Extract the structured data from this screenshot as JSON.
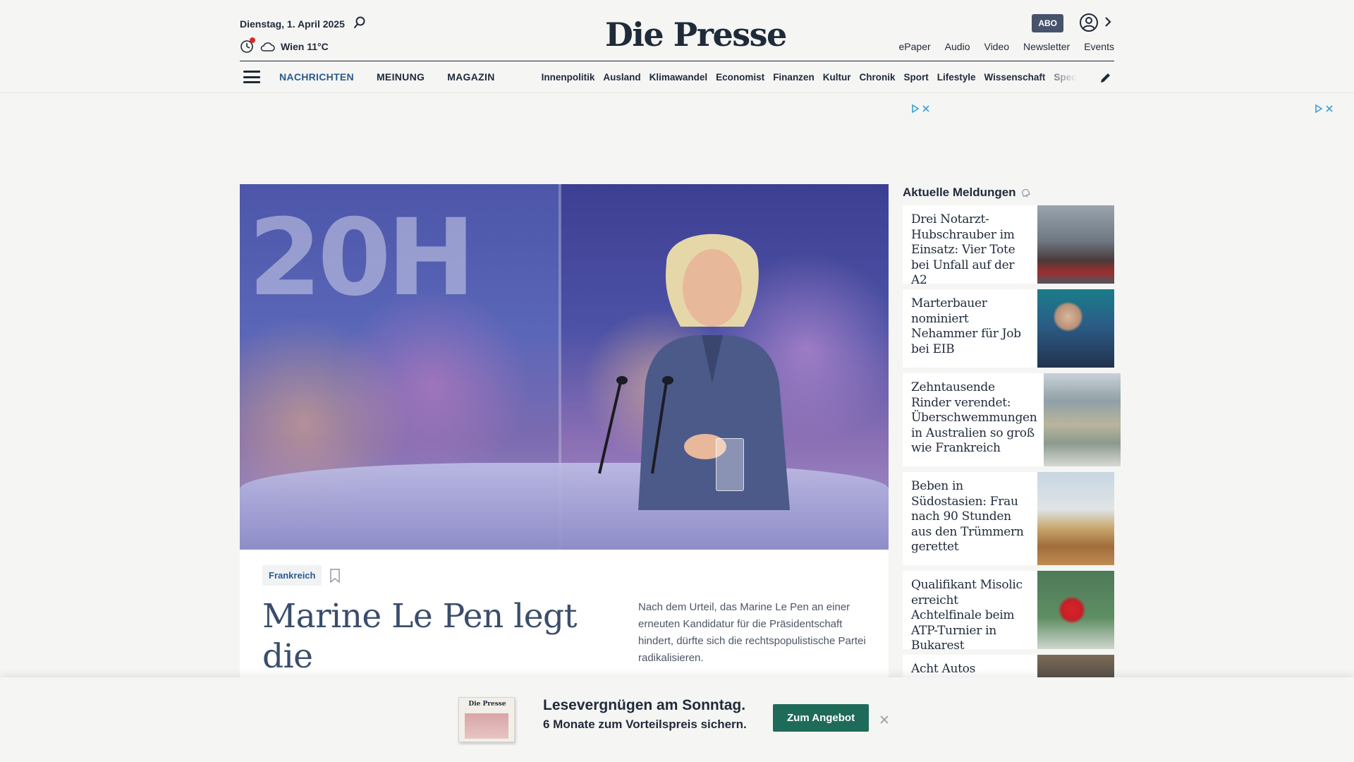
{
  "header": {
    "date": "Dienstag, 1. April 2025",
    "weather": "Wien 11°C",
    "logo": "Die Presse",
    "abo_label": "ABO",
    "top_links": [
      "ePaper",
      "Audio",
      "Video",
      "Newsletter",
      "Events"
    ]
  },
  "nav": {
    "main_tabs": [
      "NACHRICHTEN",
      "MEINUNG",
      "MAGAZIN"
    ],
    "sub_links": [
      "Innenpolitik",
      "Ausland",
      "Klimawandel",
      "Economist",
      "Finanzen",
      "Kultur",
      "Chronik",
      "Sport",
      "Lifestyle",
      "Wissenschaft",
      "Spectrum"
    ]
  },
  "hero": {
    "screen_text": "20H",
    "tag": "Frankreich",
    "headline": "Marine Le Pen legt die Glacéhandschuhe",
    "teaser": "Nach dem Urteil, das Marine Le Pen an einer erneuten Kandidatur für die Präsidentschaft hindert, dürfte sich die rechtspopulistische Partei radikalisieren."
  },
  "sidebar": {
    "title": "Aktuelle Meldungen",
    "items": [
      {
        "title": "Drei Notarzt-Hubschrauber im Einsatz: Vier Tote bei Unfall auf der A2"
      },
      {
        "title": "Marterbauer nominiert Nehammer für Job bei EIB"
      },
      {
        "title": "Zehntausende Rinder verendet: Überschwemmungen in Australien so groß wie Frankreich"
      },
      {
        "title": "Beben in Südostasien: Frau nach 90 Stunden aus den Trümmern gerettet"
      },
      {
        "title": "Qualifikant Misolic erreicht Achtelfinale beim ATP-Turnier in Bukarest"
      },
      {
        "title": "Acht Autos"
      }
    ]
  },
  "promo": {
    "paper_logo": "Die Presse",
    "title": "Lesevergnügen am Sonntag.",
    "subtitle": "6 Monate zum Vorteilspreis sichern.",
    "button": "Zum Angebot"
  },
  "colors": {
    "brand_dark": "#1f2a3a",
    "link_blue": "#2a5a8f",
    "abo_bg": "#46536b",
    "cta_green": "#1f6b5a",
    "alert_red": "#d62b2b"
  }
}
